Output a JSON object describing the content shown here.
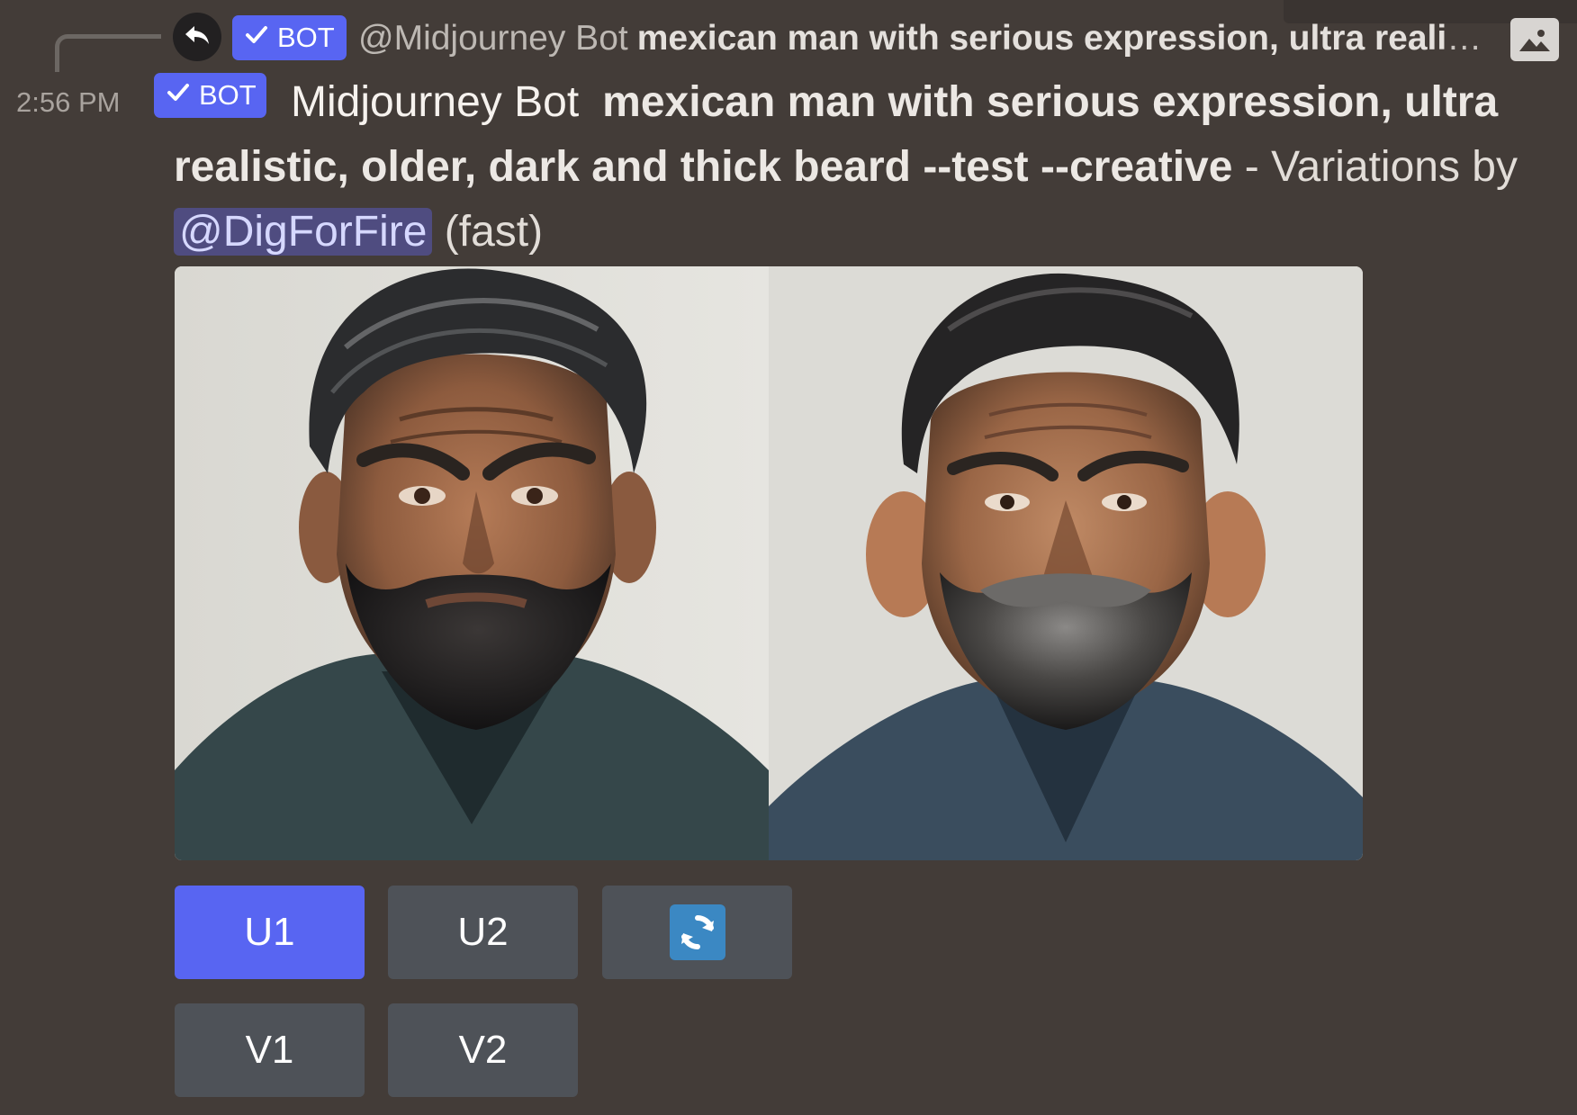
{
  "reply": {
    "bot_tag": "BOT",
    "author": "@Midjourney Bot",
    "content": "mexican man with serious expression, ultra realistic, older, dark and thick beard --test --creative"
  },
  "message": {
    "timestamp": "2:56 PM",
    "bot_tag": "BOT",
    "author": "Midjourney Bot",
    "prompt": "mexican man with serious expression, ultra realistic, older, dark and thick beard --test --creative",
    "separator": " - ",
    "variations_text": "Variations by",
    "mention": "@DigForFire",
    "speed": "(fast)"
  },
  "images": [
    {
      "name": "portrait-1"
    },
    {
      "name": "portrait-2"
    }
  ],
  "buttons": {
    "u1": "U1",
    "u2": "U2",
    "v1": "V1",
    "v2": "V2",
    "refresh_icon": "refresh-icon"
  },
  "colors": {
    "background": "#433c38",
    "blurple": "#5865f2",
    "button_gray": "#4e5258",
    "mention_bg": "#4f4c80",
    "refresh_blue": "#3b88c3"
  }
}
